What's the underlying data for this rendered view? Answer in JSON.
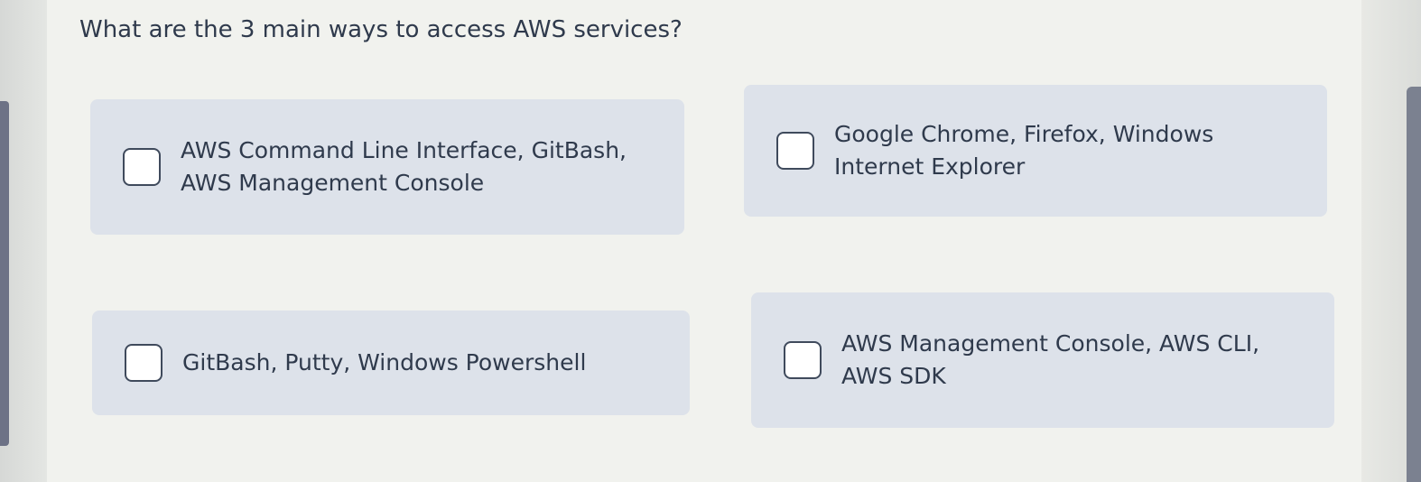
{
  "question": "What are the 3 main ways to access AWS services?",
  "options": [
    {
      "lines": [
        "AWS Command Line Interface, GitBash,",
        "AWS Management Console"
      ]
    },
    {
      "lines": [
        "Google Chrome, Firefox, Windows",
        "Internet Explorer"
      ]
    },
    {
      "lines": [
        "GitBash, Putty, Windows Powershell"
      ]
    },
    {
      "lines": [
        "AWS Management Console, AWS CLI,",
        "AWS SDK"
      ]
    }
  ]
}
